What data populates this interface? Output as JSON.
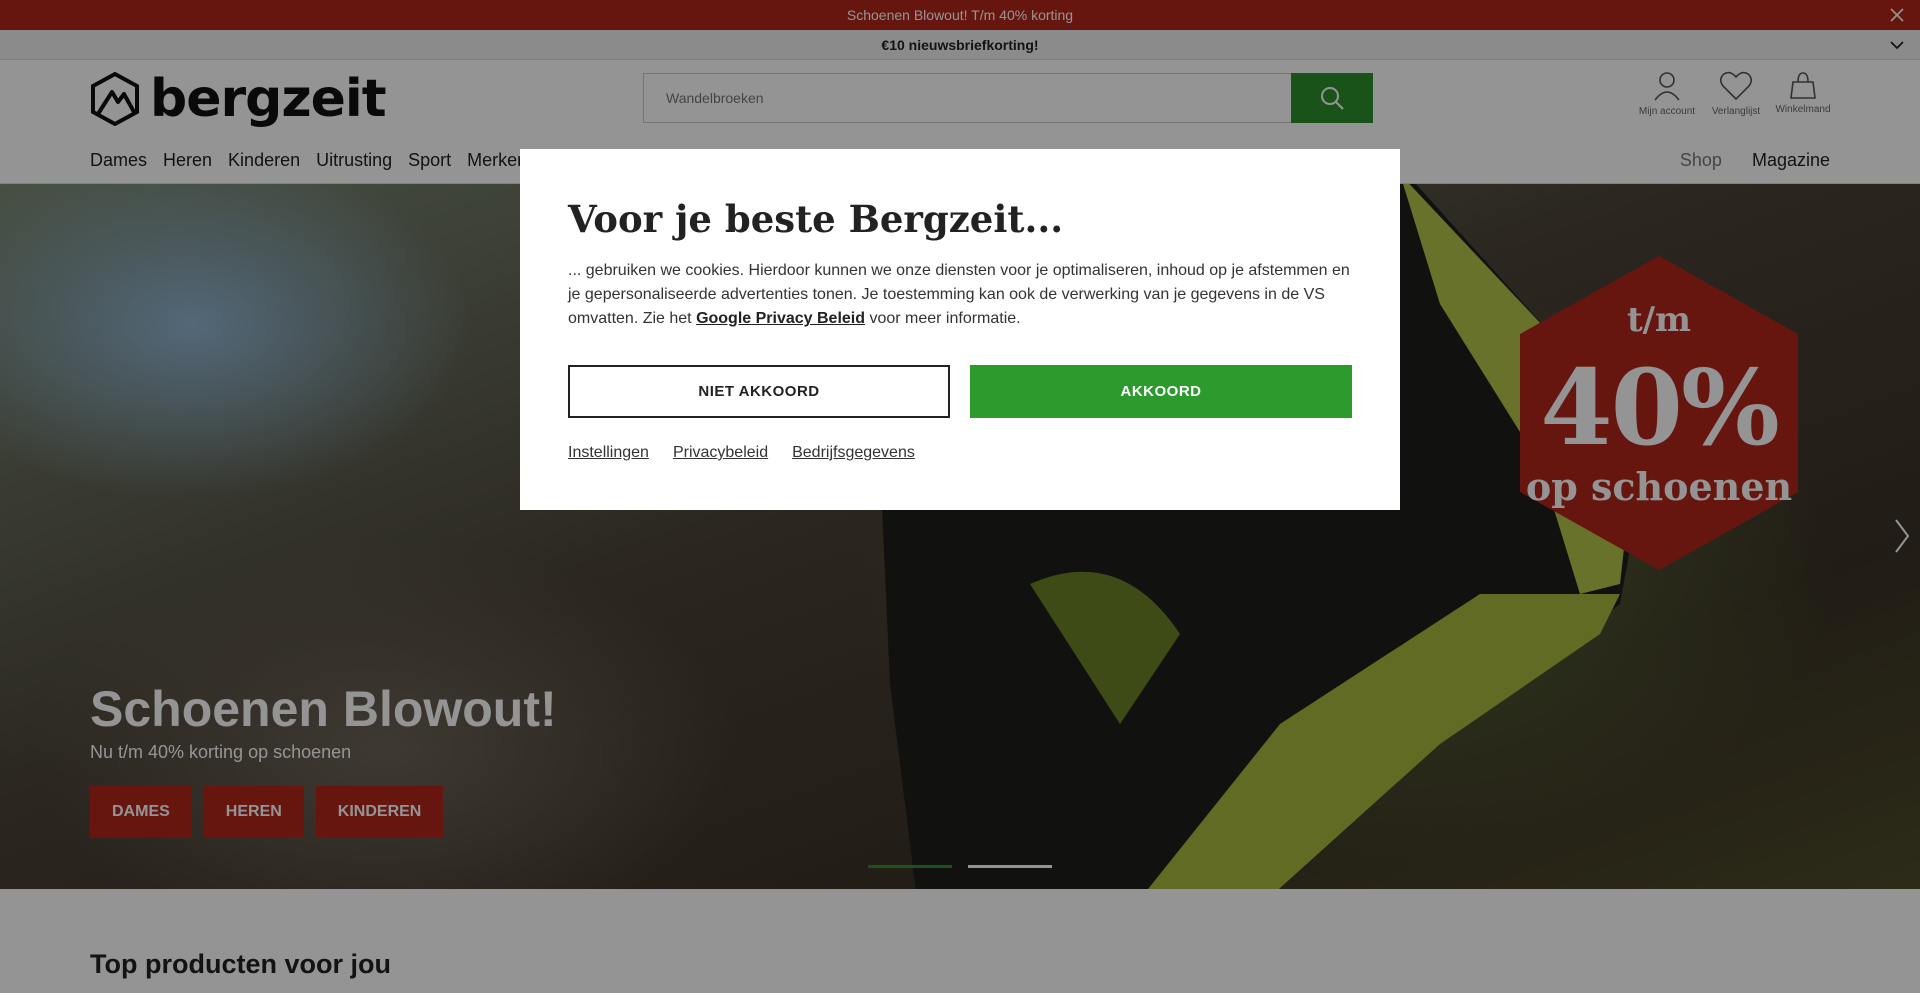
{
  "promo": {
    "top_text": "Schoenen Blowout! T/m 40% korting",
    "second_text": "€10 nieuwsbriefkorting!"
  },
  "header": {
    "logo_text": "bergzeit",
    "search_placeholder": "Wandelbroeken",
    "account_label": "Mijn account",
    "wishlist_label": "Verlanglijst",
    "cart_label": "Winkelmand"
  },
  "nav": {
    "items": [
      "Dames",
      "Heren",
      "Kinderen",
      "Uitrusting",
      "Sport",
      "Merken"
    ],
    "shop": "Shop",
    "magazine": "Magazine"
  },
  "hero": {
    "badge_top": "t/m",
    "badge_mid": "40%",
    "badge_bottom": "op schoenen",
    "title": "Schoenen Blowout!",
    "subtitle": "Nu t/m 40% korting op schoenen",
    "buttons": [
      "DAMES",
      "HEREN",
      "KINDEREN"
    ]
  },
  "section": {
    "title": "Top producten voor jou"
  },
  "modal": {
    "title": "Voor je beste Bergzeit...",
    "text_before_link": "... gebruiken we cookies. Hierdoor kunnen we onze diensten voor je optimaliseren, inhoud op je afstemmen en je gepersonaliseerde advertenties tonen. Je toestemming kan ook de verwerking van je gegevens in de VS omvatten. Zie het ",
    "link_text": "Google Privacy Beleid",
    "text_after_link": " voor meer informatie.",
    "deny_label": "NIET AKKOORD",
    "accept_label": "AKKOORD",
    "links": [
      "Instellingen",
      "Privacybeleid",
      "Bedrijfsgegevens"
    ]
  },
  "colors": {
    "brand_red": "#b2271a",
    "brand_green": "#2d8f2d"
  }
}
